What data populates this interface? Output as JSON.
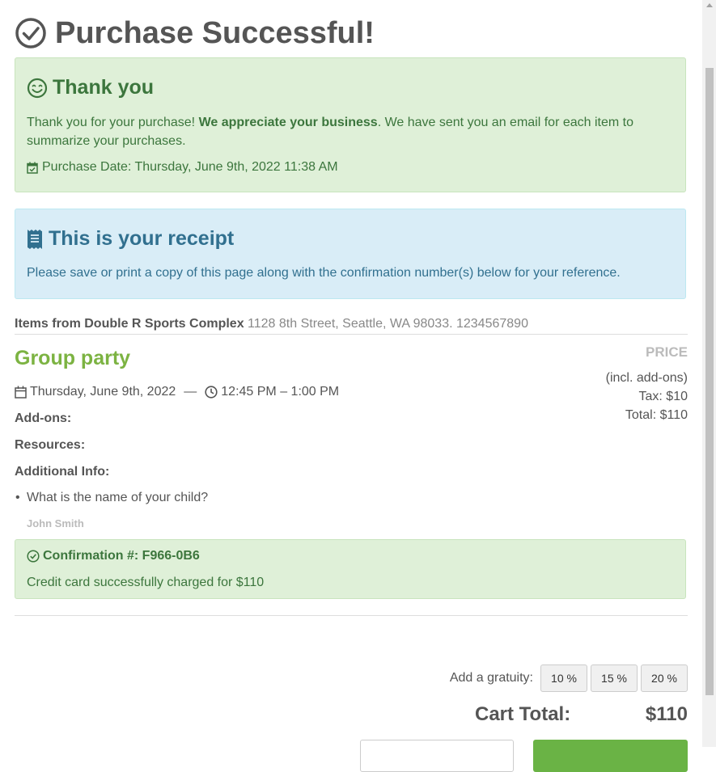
{
  "page": {
    "title": "Purchase Successful!"
  },
  "thank_you": {
    "heading": "Thank you",
    "text_before": "Thank you for your purchase! ",
    "text_bold": "We appreciate your business",
    "text_after": ". We have sent you an email for each item to summarize your purchases.",
    "purchase_date": "Purchase Date: Thursday, June 9th, 2022 11:38 AM"
  },
  "receipt": {
    "heading": "This is your receipt",
    "text": "Please save or print a copy of this page along with the confirmation number(s) below for your reference."
  },
  "vendor": {
    "label": "Items from Double R Sports Complex",
    "address": " 1128 8th Street, Seattle, WA 98033. 1234567890"
  },
  "item": {
    "title": "Group party",
    "date": "Thursday, June 9th, 2022",
    "separator": "—",
    "time": "12:45 PM – 1:00 PM",
    "addons_label": "Add-ons:",
    "resources_label": "Resources:",
    "additional_info_label": "Additional Info:",
    "question": "What is the name of your child?",
    "answer": "John Smith"
  },
  "price": {
    "header": "PRICE",
    "note": "(incl. add-ons)",
    "tax": "Tax: $10",
    "total": "Total: $110"
  },
  "confirmation": {
    "heading": "Confirmation #: F966-0B6",
    "text": "Credit card successfully charged for $110"
  },
  "gratuity": {
    "label": "Add a gratuity:",
    "options": [
      "10 %",
      "15 %",
      "20 %"
    ]
  },
  "cart": {
    "label": "Cart Total:",
    "value": "$110"
  },
  "colors": {
    "success_bg": "#dff0d8",
    "info_bg": "#d9edf7",
    "accent_green": "#7cb342",
    "button_green": "#6ab345"
  }
}
